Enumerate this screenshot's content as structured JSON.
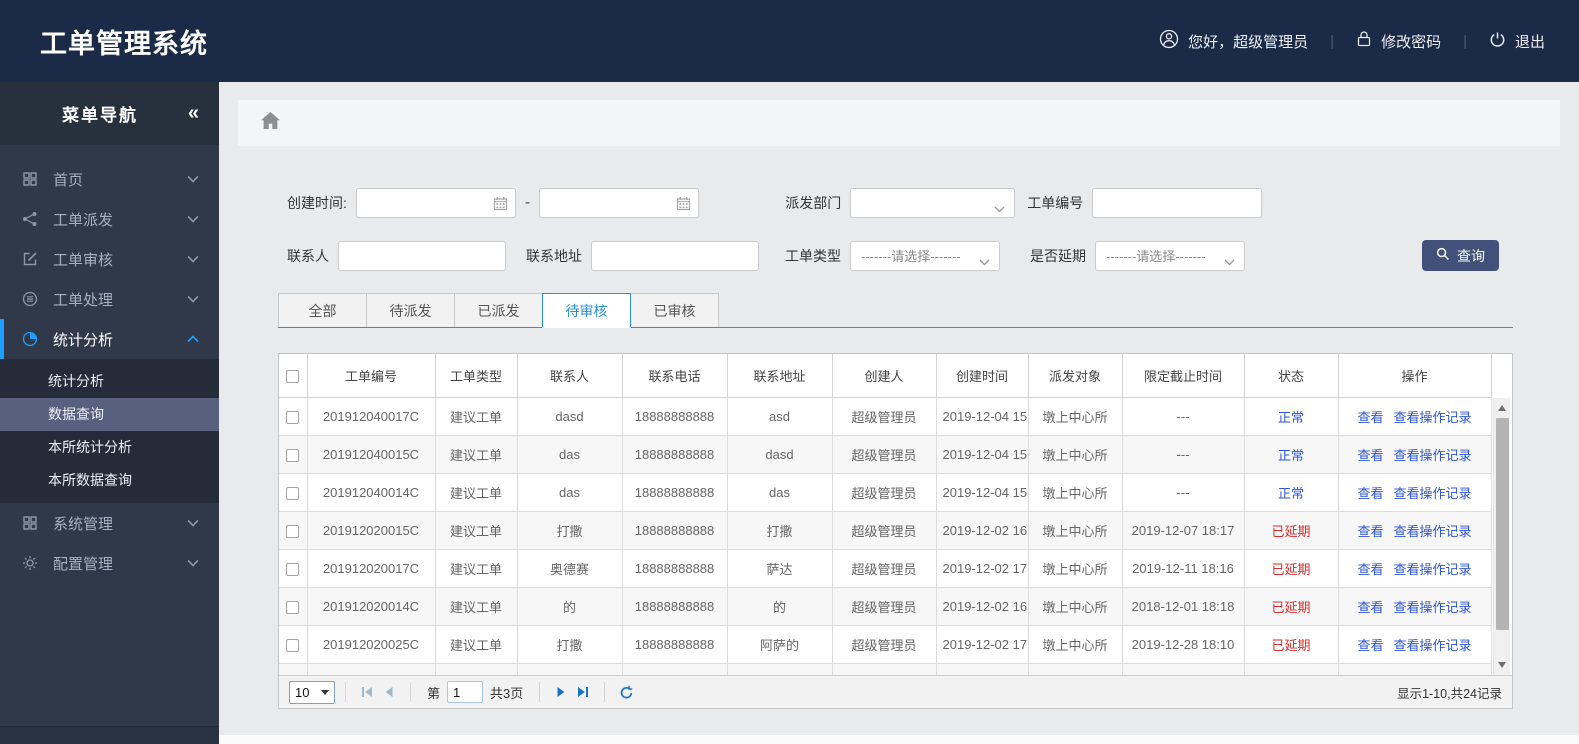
{
  "colors": {
    "header_bg": "#1b2a46",
    "sidebar_bg": "#30394a",
    "accent_blue": "#1e9fff",
    "tab_blue": "#2a91d8",
    "link_blue": "#2d55d9",
    "status_normal_color": "#2d55d9",
    "status_delayed_color": "#df2a2a",
    "search_button_bg": "#415179"
  },
  "header": {
    "title": "工单管理系统",
    "greeting": "您好，超级管理员",
    "change_password": "修改密码",
    "logout": "退出"
  },
  "sidebar": {
    "title": "菜单导航",
    "collapse_icon": "«",
    "items": [
      {
        "label": "首页",
        "icon": "grid-icon"
      },
      {
        "label": "工单派发",
        "icon": "share-icon"
      },
      {
        "label": "工单审核",
        "icon": "edit-icon"
      },
      {
        "label": "工单处理",
        "icon": "process-icon"
      },
      {
        "label": "统计分析",
        "icon": "pie-icon",
        "expanded": true,
        "children": [
          {
            "label": "统计分析"
          },
          {
            "label": "数据查询",
            "selected": true
          },
          {
            "label": "本所统计分析"
          },
          {
            "label": "本所数据查询"
          }
        ]
      },
      {
        "label": "系统管理",
        "icon": "grid-icon"
      },
      {
        "label": "配置管理",
        "icon": "gear-icon"
      }
    ]
  },
  "filters": {
    "created_time_label": "创建时间:",
    "range_separator": "-",
    "dispatch_dept_label": "派发部门",
    "order_no_label": "工单编号",
    "contact_label": "联系人",
    "address_label": "联系地址",
    "order_type_label": "工单类型",
    "delay_label": "是否延期",
    "select_placeholder": "-------请选择-------",
    "search_button": "查询"
  },
  "tabs": [
    {
      "label": "全部"
    },
    {
      "label": "待派发"
    },
    {
      "label": "已派发"
    },
    {
      "label": "待审核",
      "active": true
    },
    {
      "label": "已审核"
    }
  ],
  "table": {
    "columns": [
      "工单编号",
      "工单类型",
      "联系人",
      "联系电话",
      "联系地址",
      "创建人",
      "创建时间",
      "派发对象",
      "限定截止时间",
      "状态",
      "操作"
    ],
    "actions": {
      "view": "查看",
      "view_log": "查看操作记录"
    },
    "rows": [
      {
        "order_no": "201912040017C",
        "type": "建议工单",
        "contact": "dasd",
        "phone": "18888888888",
        "address": "asd",
        "creator": "超级管理员",
        "created": "2019-12-04 15",
        "target": "墩上中心所",
        "deadline": "---",
        "status": "正常"
      },
      {
        "order_no": "201912040015C",
        "type": "建议工单",
        "contact": "das",
        "phone": "18888888888",
        "address": "dasd",
        "creator": "超级管理员",
        "created": "2019-12-04 15",
        "target": "墩上中心所",
        "deadline": "---",
        "status": "正常"
      },
      {
        "order_no": "201912040014C",
        "type": "建议工单",
        "contact": "das",
        "phone": "18888888888",
        "address": "das",
        "creator": "超级管理员",
        "created": "2019-12-04 15",
        "target": "墩上中心所",
        "deadline": "---",
        "status": "正常"
      },
      {
        "order_no": "201912020015C",
        "type": "建议工单",
        "contact": "打撒",
        "phone": "18888888888",
        "address": "打撒",
        "creator": "超级管理员",
        "created": "2019-12-02 16",
        "target": "墩上中心所",
        "deadline": "2019-12-07 18:17",
        "status": "已延期"
      },
      {
        "order_no": "201912020017C",
        "type": "建议工单",
        "contact": "奥德赛",
        "phone": "18888888888",
        "address": "萨达",
        "creator": "超级管理员",
        "created": "2019-12-02 17",
        "target": "墩上中心所",
        "deadline": "2019-12-11 18:16",
        "status": "已延期"
      },
      {
        "order_no": "201912020014C",
        "type": "建议工单",
        "contact": "的",
        "phone": "18888888888",
        "address": "的",
        "creator": "超级管理员",
        "created": "2019-12-02 16",
        "target": "墩上中心所",
        "deadline": "2018-12-01 18:18",
        "status": "已延期"
      },
      {
        "order_no": "201912020025C",
        "type": "建议工单",
        "contact": "打撒",
        "phone": "18888888888",
        "address": "阿萨的",
        "creator": "超级管理员",
        "created": "2019-12-02 17",
        "target": "墩上中心所",
        "deadline": "2019-12-28 18:10",
        "status": "已延期"
      }
    ]
  },
  "pager": {
    "page_size": "10",
    "page_prefix": "第",
    "page": "1",
    "total_pages": "共3页",
    "summary": "显示1-10,共24记录"
  }
}
